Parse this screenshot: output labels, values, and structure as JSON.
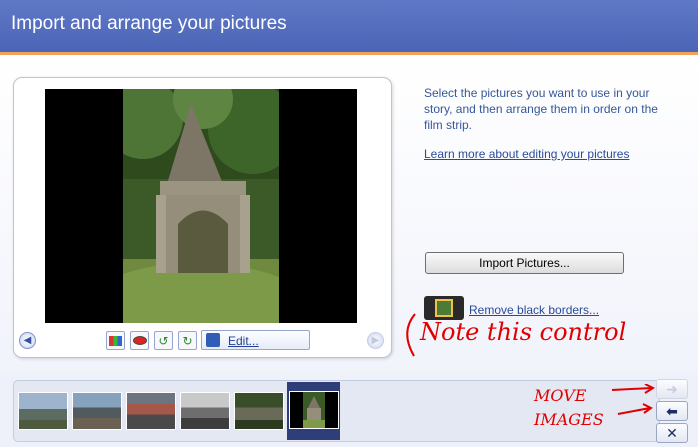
{
  "header": {
    "title": "Import and arrange your pictures"
  },
  "instructions": {
    "text": "Select the pictures you want to use in your story, and then arrange them in order on the film strip.",
    "learn_more": "Learn more about editing your pictures"
  },
  "buttons": {
    "import": "Import Pictures...",
    "edit": "Edit...",
    "remove_borders": "Remove black borders..."
  },
  "icons": {
    "prev": "left-arrow-icon",
    "next": "right-arrow-icon",
    "move_right": "right-arrow-icon",
    "move_left": "left-arrow-icon",
    "delete": "close-icon"
  },
  "annotations": {
    "note": "Note this control",
    "move": "MOVE IMAGES"
  },
  "colors": {
    "header": "#5a74c2",
    "accent": "#f0a45a",
    "annotation": "#e00000"
  }
}
